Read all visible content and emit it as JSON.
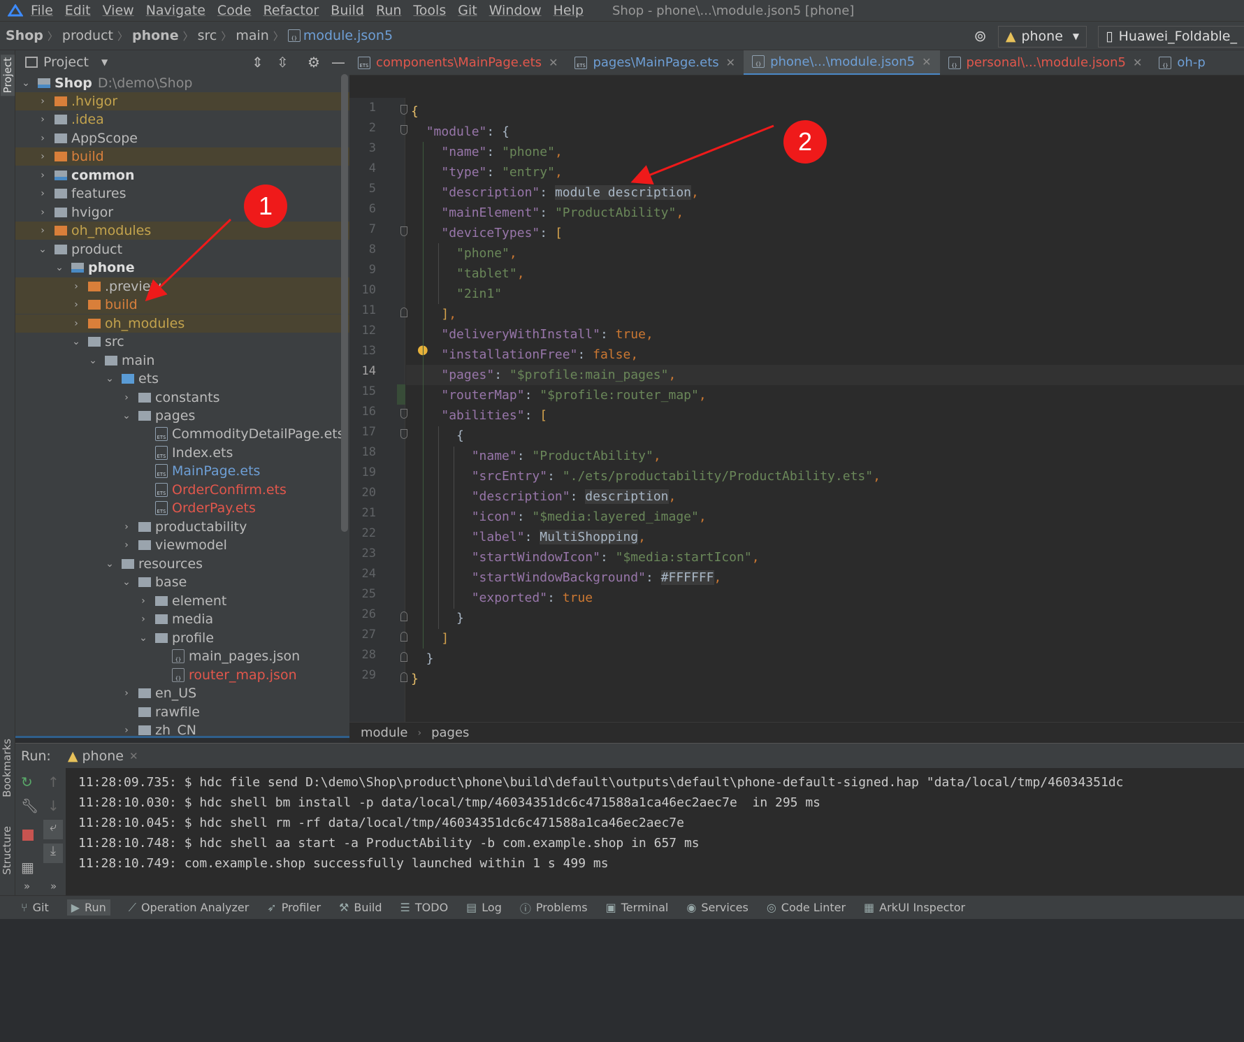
{
  "menubar": {
    "items": [
      "File",
      "Edit",
      "View",
      "Navigate",
      "Code",
      "Refactor",
      "Build",
      "Run",
      "Tools",
      "Git",
      "Window",
      "Help"
    ],
    "window_title": "Shop - phone\\...\\module.json5 [phone]"
  },
  "navbar": {
    "breadcrumbs": [
      "Shop",
      "product",
      "phone",
      "src",
      "main",
      "module.json5"
    ],
    "run_config": "phone",
    "device": "Huawei_Foldable_"
  },
  "side_strip": {
    "project": "Project",
    "bookmarks": "Bookmarks",
    "structure": "Structure"
  },
  "project_panel": {
    "title": "Project",
    "root_name": "Shop",
    "root_path": "D:\\demo\\Shop",
    "tree": [
      "Shop",
      ".hvigor",
      ".idea",
      "AppScope",
      "build",
      "common",
      "features",
      "hvigor",
      "oh_modules",
      "product",
      "phone",
      ".preview",
      "build",
      "oh_modules",
      "src",
      "main",
      "ets",
      "constants",
      "pages",
      "CommodityDetailPage.ets",
      "Index.ets",
      "MainPage.ets",
      "OrderConfirm.ets",
      "OrderPay.ets",
      "productability",
      "viewmodel",
      "resources",
      "base",
      "element",
      "media",
      "profile",
      "main_pages.json",
      "router_map.json",
      "en_US",
      "rawfile",
      "zh_CN"
    ]
  },
  "editor_tabs": [
    {
      "label": "components\\MainPage.ets"
    },
    {
      "label": "pages\\MainPage.ets"
    },
    {
      "label": "phone\\...\\module.json5"
    },
    {
      "label": "personal\\...\\module.json5"
    },
    {
      "label": "oh-p"
    }
  ],
  "code_lines": [
    "{",
    "  \"module\": {",
    "    \"name\": \"phone\",",
    "    \"type\": \"entry\",",
    "    \"description\": module description,",
    "    \"mainElement\": \"ProductAbility\",",
    "    \"deviceTypes\": [",
    "      \"phone\",",
    "      \"tablet\",",
    "      \"2in1\"",
    "    ],",
    "    \"deliveryWithInstall\": true,",
    "    \"installationFree\": false,",
    "    \"pages\": \"$profile:main_pages\",",
    "    \"routerMap\": \"$profile:router_map\",",
    "    \"abilities\": [",
    "      {",
    "        \"name\": \"ProductAbility\",",
    "        \"srcEntry\": \"./ets/productability/ProductAbility.ets\",",
    "        \"description\": description,",
    "        \"icon\": \"$media:layered_image\",",
    "        \"label\": MultiShopping,",
    "        \"startWindowIcon\": \"$media:startIcon\",",
    "        \"startWindowBackground\": #FFFFFF,",
    "        \"exported\": true",
    "      }",
    "    ]",
    "  }",
    "}"
  ],
  "line_numbers": [
    "1",
    "2",
    "3",
    "4",
    "5",
    "6",
    "7",
    "8",
    "9",
    "10",
    "11",
    "12",
    "13",
    "14",
    "15",
    "16",
    "17",
    "18",
    "19",
    "20",
    "21",
    "22",
    "23",
    "24",
    "25",
    "26",
    "27",
    "28",
    "29"
  ],
  "editor_breadcrumb": [
    "module",
    "pages"
  ],
  "run_panel": {
    "label": "Run:",
    "config": "phone",
    "console_lines": [
      "11:28:09.735: $ hdc file send D:\\demo\\Shop\\product\\phone\\build\\default\\outputs\\default\\phone-default-signed.hap \"data/local/tmp/46034351dc",
      "11:28:10.030: $ hdc shell bm install -p data/local/tmp/46034351dc6c471588a1ca46ec2aec7e  in 295 ms",
      "11:28:10.045: $ hdc shell rm -rf data/local/tmp/46034351dc6c471588a1ca46ec2aec7e",
      "11:28:10.748: $ hdc shell aa start -a ProductAbility -b com.example.shop in 657 ms",
      "11:28:10.749: com.example.shop successfully launched within 1 s 499 ms"
    ]
  },
  "status_bar": [
    "Git",
    "Run",
    "Operation Analyzer",
    "Profiler",
    "Build",
    "TODO",
    "Log",
    "Problems",
    "Terminal",
    "Services",
    "Code Linter",
    "ArkUI Inspector"
  ],
  "callouts": [
    "1",
    "2"
  ],
  "colors": {
    "annotation": "#ef1a1a",
    "excluded_folder": "#d9803c",
    "active_tab": "#4a88c7"
  }
}
